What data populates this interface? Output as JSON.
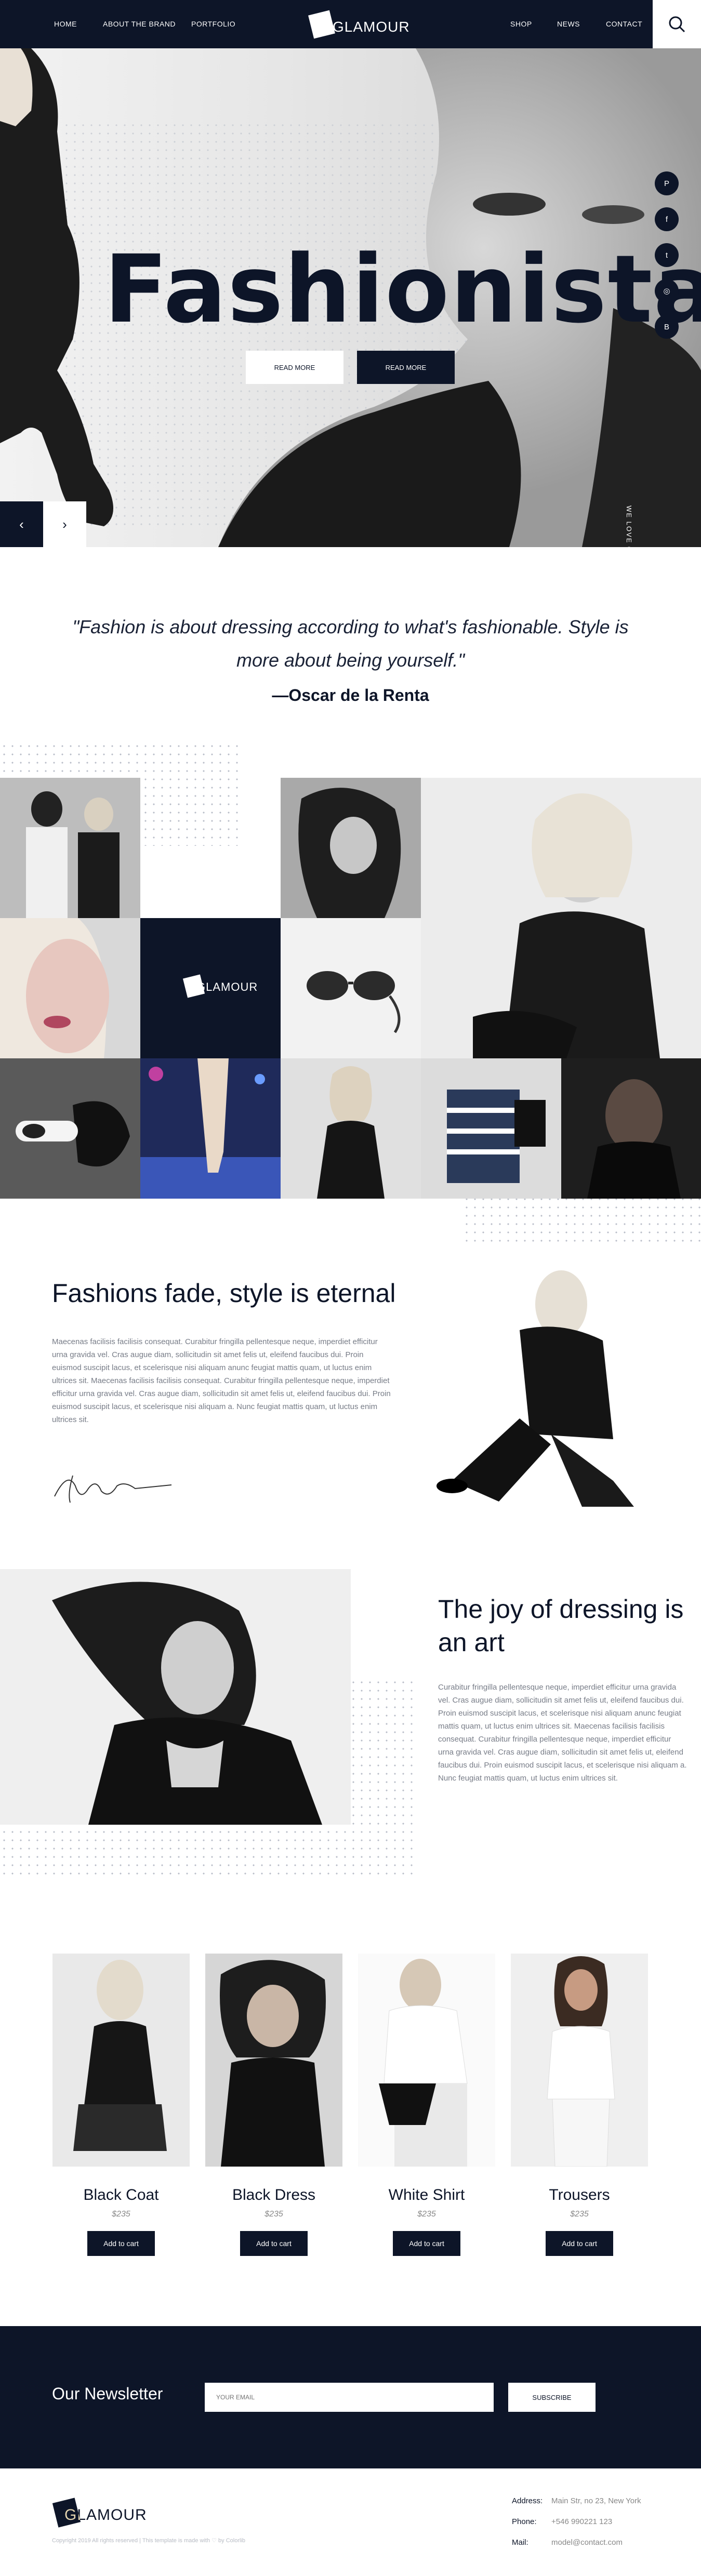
{
  "nav": {
    "links_left": [
      "HOME",
      "ABOUT THE BRAND",
      "PORTFOLIO"
    ],
    "links_right": [
      "SHOP",
      "NEWS",
      "CONTACT"
    ],
    "logo": "GLAMOUR",
    "search_icon": "search-icon"
  },
  "hero": {
    "title": "Fashionista",
    "button1": "READ MORE",
    "button2": "READ MORE",
    "vertical_text": "WE LOVE OUR BRAND",
    "social_icons": [
      "pinterest-icon",
      "facebook-icon",
      "twitter-icon",
      "dribbble-icon",
      "behance-icon"
    ],
    "social_glyphs": [
      "P",
      "f",
      "t",
      "◎",
      "B"
    ],
    "prev": "‹",
    "next": "›"
  },
  "quote": {
    "text": "\"Fashion is about dressing according to what's fashionable. Style is more about being yourself.\"",
    "author": "—Oscar de la Renta"
  },
  "gallery": {
    "logo": "GLAMOUR"
  },
  "section1": {
    "title": "Fashions fade, style is eternal",
    "body": "Maecenas facilisis facilisis consequat. Curabitur fringilla pellentesque neque, imperdiet efficitur urna gravida vel. Cras augue diam, sollicitudin sit amet felis ut, eleifend faucibus dui. Proin euismod suscipit lacus, et scelerisque nisi aliquam anunc feugiat mattis quam, ut luctus enim ultrices sit. Maecenas facilisis facilisis consequat. Curabitur fringilla pellentesque neque, imperdiet efficitur urna gravida vel. Cras augue diam, sollicitudin sit amet felis ut, eleifend faucibus dui. Proin euismod suscipit lacus, et scelerisque nisi aliquam a. Nunc feugiat mattis quam, ut luctus enim ultrices sit.",
    "signature": "Shannon"
  },
  "section2": {
    "title": "The joy of dressing is an art",
    "body": "Curabitur fringilla pellentesque neque, imperdiet efficitur urna gravida vel. Cras augue diam, sollicitudin sit amet felis ut, eleifend faucibus dui. Proin euismod suscipit lacus, et scelerisque nisi aliquam anunc feugiat mattis quam, ut luctus enim ultrices sit. Maecenas facilisis facilisis consequat. Curabitur fringilla pellentesque neque, imperdiet efficitur urna gravida vel. Cras augue diam, sollicitudin sit amet felis ut, eleifend faucibus dui. Proin euismod suscipit lacus, et scelerisque nisi aliquam a. Nunc feugiat mattis quam, ut luctus enim ultrices sit."
  },
  "products": [
    {
      "name": "Black Coat",
      "price": "$235",
      "button": "Add to cart"
    },
    {
      "name": "Black Dress",
      "price": "$235",
      "button": "Add to cart"
    },
    {
      "name": "White Shirt",
      "price": "$235",
      "button": "Add to cart"
    },
    {
      "name": "Trousers",
      "price": "$235",
      "button": "Add to cart"
    }
  ],
  "newsletter": {
    "title": "Our Newsletter",
    "placeholder": "YOUR EMAIL",
    "button": "SUBSCRIBE"
  },
  "footer": {
    "logo": "GLAMOUR",
    "copyright": "Copyright 2019 All rights reserved | This template is made with ♡ by Colorlib",
    "address_label": "Address:",
    "address": "Main Str, no 23, New York",
    "phone_label": "Phone:",
    "phone": "+546 990221 123",
    "mail_label": "Mail:",
    "mail": "model@contact.com"
  },
  "colors": {
    "navy": "#0d1528",
    "white": "#ffffff"
  }
}
